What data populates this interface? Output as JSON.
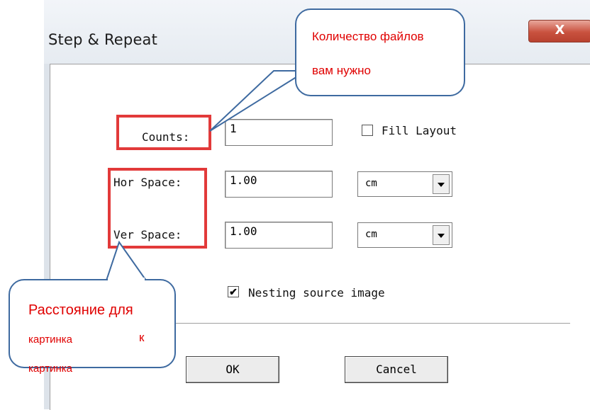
{
  "window": {
    "title": "Step & Repeat",
    "close_glyph": "X"
  },
  "fields": {
    "counts": {
      "label": "Counts:",
      "value": "1"
    },
    "hor_space": {
      "label": "Hor Space:",
      "value": "1.00",
      "unit": "cm"
    },
    "ver_space": {
      "label": "Ver Space:",
      "value": "1.00",
      "unit": "cm"
    }
  },
  "fill_layout": {
    "label": "Fill Layout",
    "checked": false
  },
  "nesting": {
    "label": "Nesting source image",
    "checked": true,
    "check_glyph": "✔"
  },
  "buttons": {
    "ok": "OK",
    "cancel": "Cancel"
  },
  "callouts": {
    "top": {
      "line1": "Количество файлов",
      "line2": "вам нужно"
    },
    "bottom": {
      "line1": "Расстояние для",
      "line2": "картинка",
      "extra": "к",
      "line3": "картинка"
    }
  },
  "colors": {
    "highlight": "#e23a3a",
    "callout_border": "#3e6aa0",
    "callout_text": "#e00000"
  }
}
